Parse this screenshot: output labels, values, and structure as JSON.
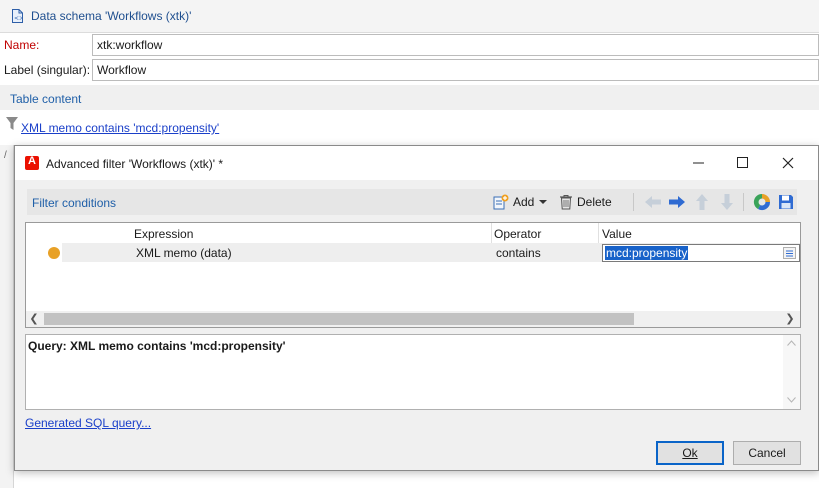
{
  "schema": {
    "title": "Data schema 'Workflows (xtk)'",
    "name_label": "Name:",
    "name_value": "xtk:workflow",
    "label_label": "Label (singular):",
    "label_value": "Workflow",
    "table_content_label": "Table content",
    "filter_link": "XML memo contains 'mcd:propensity'",
    "strip_mark": "/"
  },
  "dialog": {
    "title": "Advanced filter 'Workflows (xtk)' *",
    "window_controls": {
      "minimize": "—",
      "maximize": "☐",
      "close": "✕"
    },
    "panel": {
      "label": "Filter conditions",
      "toolbar": {
        "add_label": "Add",
        "delete_label": "Delete"
      }
    },
    "grid": {
      "columns": [
        "Expression",
        "Operator",
        "Value"
      ],
      "rows": [
        {
          "expression": "XML memo (data)",
          "operator": "contains",
          "value": "mcd:propensity",
          "status_color": "#e8a127"
        }
      ]
    },
    "query": "Query: XML memo contains 'mcd:propensity'",
    "sql_link": "Generated SQL query...",
    "buttons": {
      "ok": "Ok",
      "cancel": "Cancel"
    }
  },
  "colors": {
    "accent": "#1f5fa8",
    "link": "#1a3fc9",
    "required": "#c00000",
    "selection": "#1862c9",
    "brand": "#eb1000"
  }
}
